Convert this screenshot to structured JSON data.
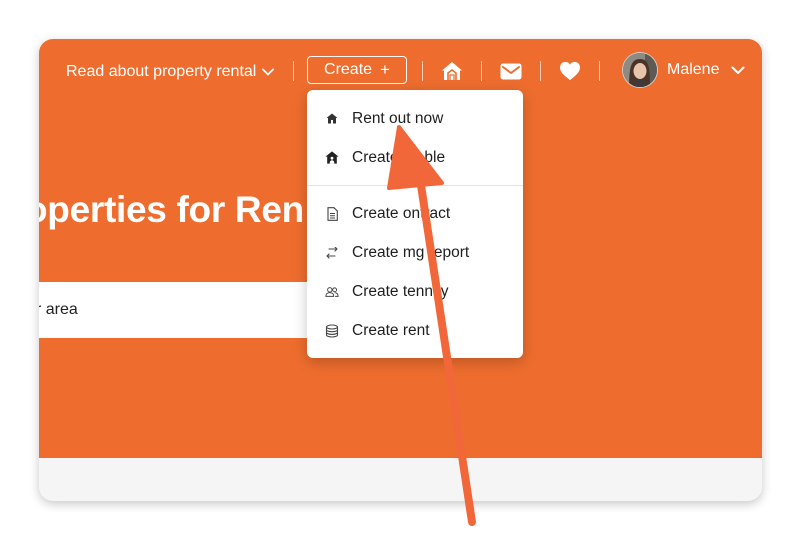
{
  "nav": {
    "read_link": "Read about property rental",
    "create_label": "Create",
    "create_plus": "+",
    "user_name": "Malene"
  },
  "hero": {
    "title": "operties for Ren",
    "search_placeholder": "r area"
  },
  "dropdown": {
    "items": [
      {
        "label": "Rent out now",
        "icon": "house-small-icon"
      },
      {
        "label": "Create ntable",
        "icon": "house-person-icon"
      },
      {
        "label": "Create ontract",
        "icon": "document-icon"
      },
      {
        "label": "Create mg report",
        "icon": "swap-arrows-icon"
      },
      {
        "label": "Create tenncy",
        "icon": "people-icon"
      },
      {
        "label": "Create rent",
        "icon": "coins-stack-icon"
      }
    ]
  },
  "colors": {
    "brand_orange": "#ee6d2e",
    "annotation_arrow": "#f2673a",
    "card_bottom": "#f5f5f5"
  }
}
